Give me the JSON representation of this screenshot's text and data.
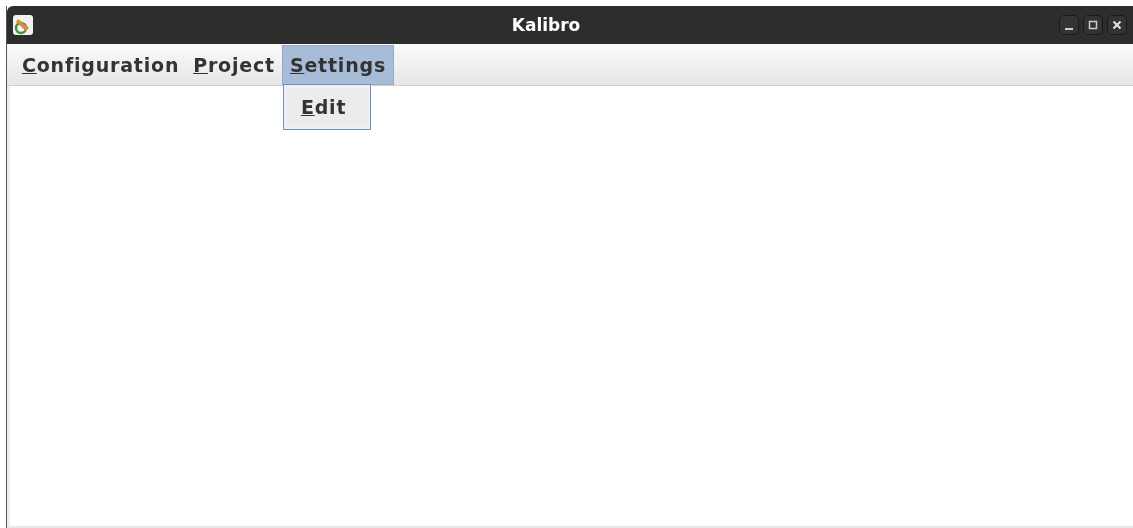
{
  "window": {
    "title": "Kalibro"
  },
  "menu_bar": [
    {
      "label": "Configuration",
      "selected": false
    },
    {
      "label": "Project",
      "selected": false
    },
    {
      "label": "Settings",
      "selected": true,
      "items": [
        {
          "label": "Edit"
        }
      ]
    }
  ]
}
